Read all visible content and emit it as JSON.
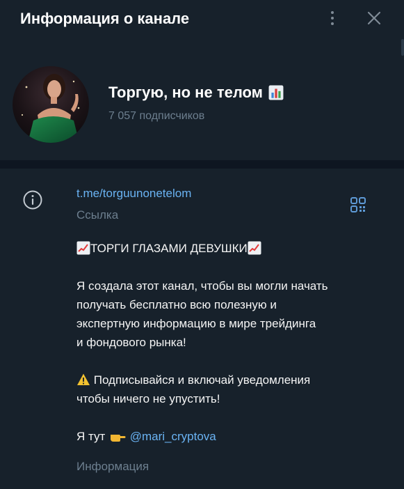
{
  "header": {
    "title": "Информация о канале"
  },
  "channel": {
    "name": "Торгую, но не телом",
    "subscribers": "7 057 подписчиков"
  },
  "info": {
    "link": "t.me/torguunonetelom",
    "link_label": "Ссылка",
    "about_label": "Информация"
  },
  "description": {
    "headline": "ТОРГИ ГЛАЗАМИ ДЕВУШКИ",
    "lines": [
      "Я создала этот канал, чтобы вы могли начать",
      "получать бесплатно всю полезную и",
      "экспертную информацию в мире трейдинга",
      "и фондового рынка!"
    ],
    "notice_lines": [
      "Подписывайся и включай уведомления",
      "чтобы ничего не упустить!"
    ],
    "contact_prefix": "Я тут",
    "mention": "@mari_cryptova"
  },
  "icons": {
    "more": "more-vertical-icon",
    "close": "close-icon",
    "info": "info-icon",
    "qr": "qr-code-icon",
    "chart": "bar-chart-emoji",
    "trend": "chart-increasing-emoji",
    "warning": "warning-emoji",
    "point": "pointing-hand-emoji"
  },
  "colors": {
    "background": "#17212b",
    "separator": "#0e1621",
    "accent_link": "#6ab3f3",
    "secondary_text": "#6d7f8f",
    "primary_text": "#f5f5f5"
  }
}
